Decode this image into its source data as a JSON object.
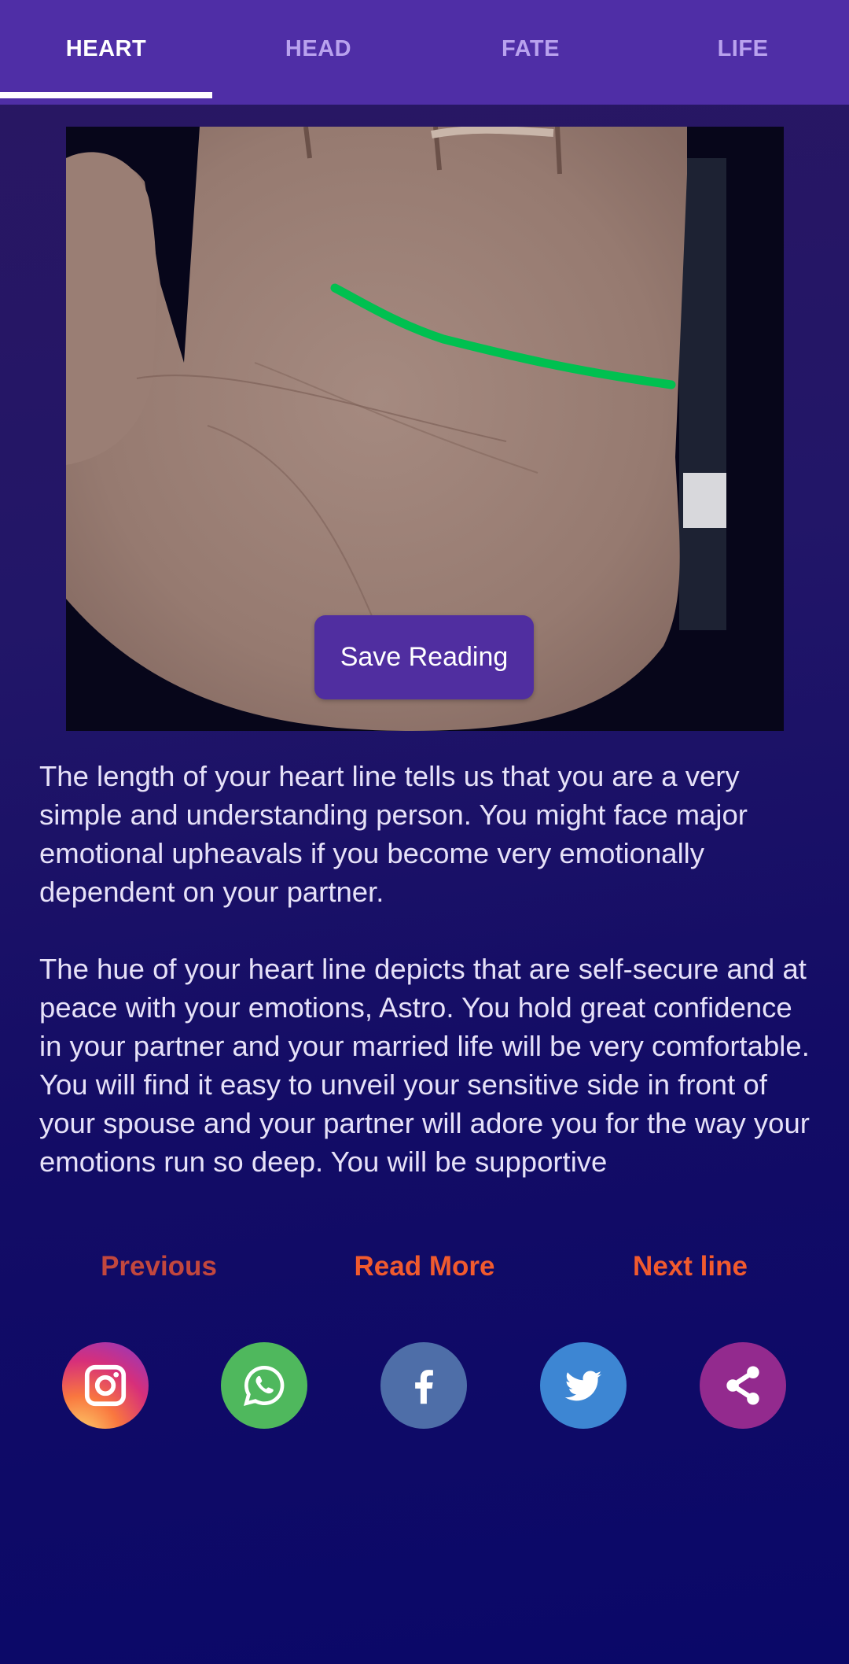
{
  "tabs": [
    {
      "label": "HEART",
      "active": true
    },
    {
      "label": "HEAD",
      "active": false
    },
    {
      "label": "FATE",
      "active": false
    },
    {
      "label": "LIFE",
      "active": false
    }
  ],
  "palm_image": {
    "description": "Photo of an open palm with the heart line traced in green",
    "trace_color": "#00c050"
  },
  "save_button": {
    "label": "Save Reading"
  },
  "reading": {
    "paragraphs": [
      "The length of your heart line tells us that you are a very simple and understanding person. You might face major emotional upheavals if you become very emotionally dependent on your partner.",
      "The hue of your heart line depicts that are self-secure and at peace with your emotions, Astro. You hold great confidence in your partner and your married life will be very comfortable. You will find it easy to unveil your sensitive side in front of your spouse and your partner will adore you for the way your emotions run so deep. You will be supportive"
    ]
  },
  "navigation": {
    "previous": "Previous",
    "read_more": "Read More",
    "next": "Next line"
  },
  "share": [
    {
      "icon": "instagram-icon",
      "label": "Instagram"
    },
    {
      "icon": "whatsapp-icon",
      "label": "WhatsApp"
    },
    {
      "icon": "facebook-icon",
      "label": "Facebook"
    },
    {
      "icon": "twitter-icon",
      "label": "Twitter"
    },
    {
      "icon": "share-icon",
      "label": "Share"
    }
  ],
  "colors": {
    "tabbar": "#4f2ea6",
    "accent_orange": "#f15a2e",
    "previous_red": "#c2473e",
    "text": "#e6e1f8"
  }
}
